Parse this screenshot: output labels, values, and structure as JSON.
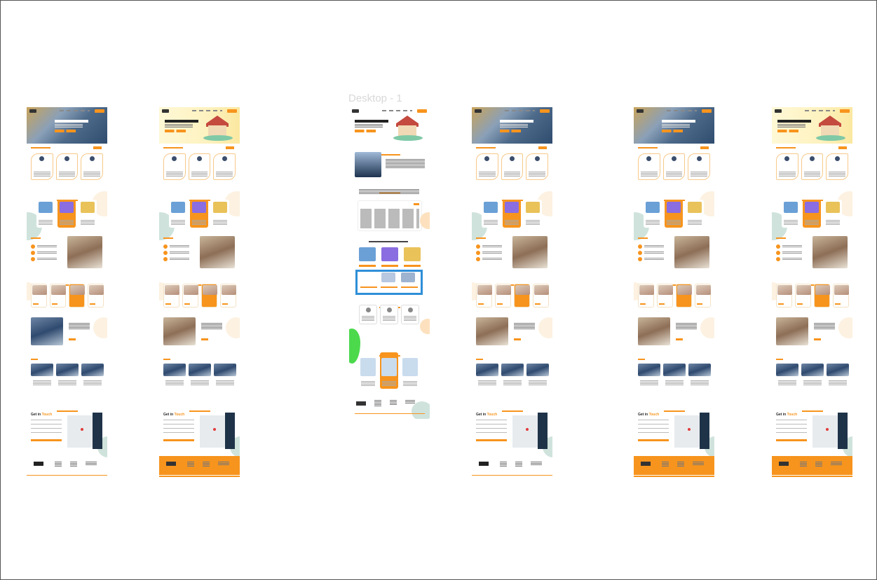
{
  "canvas": {
    "background": "#ffffff",
    "border_color": "#555555"
  },
  "frame_label": "Desktop - 1",
  "colors": {
    "accent": "#f7941d",
    "navy": "#1f3348",
    "mint": "#cfe3dc",
    "peach": "#fdf1e1",
    "selection": "#2f8fd8",
    "green_blob": "#4cd94c"
  },
  "frames": [
    {
      "name": "frame-1",
      "hero_style": "skyscraper",
      "footer_style": "white",
      "team_photo": "group-hands"
    },
    {
      "name": "frame-2",
      "hero_style": "house",
      "footer_style": "orange",
      "team_photo": "couple"
    },
    {
      "name": "desktop-1",
      "hero_style": "house",
      "footer_style": "white",
      "selected_section": true
    },
    {
      "name": "frame-4",
      "hero_style": "skyscraper",
      "footer_style": "white",
      "team_photo": "couple"
    },
    {
      "name": "frame-5",
      "hero_style": "skyscraper",
      "footer_style": "orange",
      "team_photo": "couple"
    },
    {
      "name": "frame-6",
      "hero_style": "house",
      "footer_style": "orange",
      "team_photo": "couple"
    }
  ],
  "contact": {
    "heading_start": "Get in ",
    "heading_accent": "Touch"
  }
}
